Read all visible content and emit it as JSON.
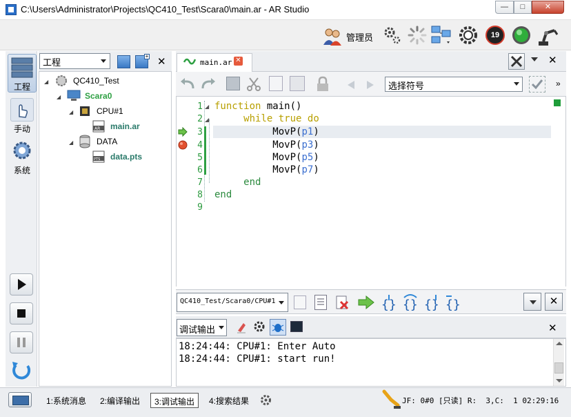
{
  "window": {
    "title": "C:\\Users\\Administrator\\Projects\\QC410_Test\\Scara0\\main.ar - AR Studio",
    "min_glyph": "—",
    "max_glyph": "□",
    "close_glyph": "✕"
  },
  "topbar": {
    "user_label": "管理员",
    "speed_badge": "19"
  },
  "leftbar": {
    "project_label": "工程",
    "manual_label": "手动",
    "system_label": "系统"
  },
  "project_panel": {
    "selector_value": "工程",
    "close_glyph": "✕",
    "tree": {
      "root": "QC410_Test",
      "robot": "Scara0",
      "cpu": "CPU#1",
      "main_file": "main.ar",
      "data_folder": "DATA",
      "data_file": "data.pts"
    }
  },
  "editor": {
    "tab_label": "main.ar",
    "tab_close": "✕",
    "symbol_select": "选择符号",
    "more_glyph": "»",
    "panel_close": "✕",
    "line_numbers": [
      "1",
      "2",
      "3",
      "4",
      "5",
      "6",
      "7",
      "8",
      "9"
    ],
    "code": {
      "l1_kw": "function",
      "l1_rest": " main()",
      "l2_kw1": "while",
      "l2_kw2": "true",
      "l2_kw3": "do",
      "l3_fn": "MovP",
      "l3_arg": "p1",
      "l4_fn": "MovP",
      "l4_arg": "p3",
      "l5_fn": "MovP",
      "l5_arg": "p5",
      "l6_fn": "MovP",
      "l6_arg": "p7",
      "l7_kw": "end",
      "l8_kw": "end"
    }
  },
  "path_bar": {
    "path_value": "QC410_Test/Scara0/CPU#1"
  },
  "output": {
    "selector_value": "调试输出",
    "close_glyph": "✕",
    "lines": [
      "18:24:44: CPU#1: Enter Auto",
      "18:24:44: CPU#1: start run!"
    ]
  },
  "statusbar": {
    "tabs": [
      "1:系统消息",
      "2:编译输出",
      "3:调试输出",
      "4:搜索结果"
    ],
    "status_text": "JF: 0#0 [只读] R:  3,C:  1 02:29:16"
  },
  "colors": {
    "accent_blue": "#2a6fc9",
    "line_number_green": "#2b9a3e",
    "keyword_yellow": "#b8a000",
    "argument_blue": "#3b6fd0",
    "breakpoint_red": "#d83a1f",
    "run_green": "#2ea043"
  }
}
